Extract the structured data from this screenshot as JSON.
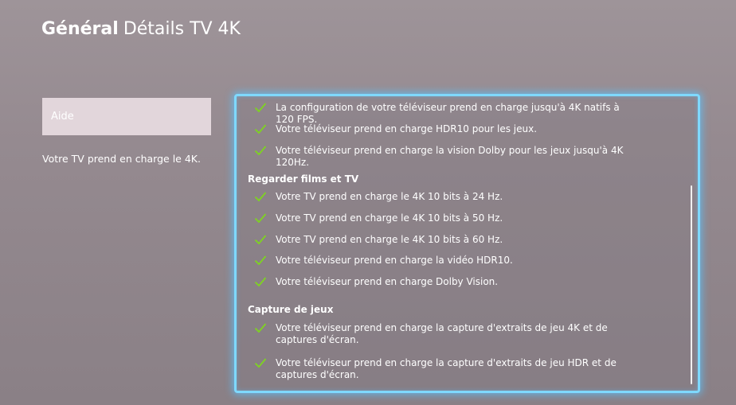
{
  "header": {
    "section": "Général",
    "title": "Détails TV 4K"
  },
  "sidebar": {
    "help_button": "Aide",
    "description": "Votre TV prend en charge le 4K."
  },
  "details": {
    "items_top": [
      "La configuration de votre téléviseur prend en charge jusqu'à 4K natifs à 120 FPS.",
      "Votre téléviseur prend en charge HDR10 pour les jeux.",
      "Votre téléviseur prend en charge la vision Dolby pour les jeux jusqu'à 4K 120Hz."
    ],
    "section_movies": "Regarder films et TV",
    "items_movies": [
      "Votre TV prend en charge le 4K 10 bits à 24 Hz.",
      "Votre TV prend en charge le 4K 10 bits à 50 Hz.",
      "Votre TV prend en charge le 4K 10 bits à 60 Hz.",
      "Votre téléviseur prend en charge la vidéo HDR10.",
      "Votre téléviseur prend en charge Dolby Vision."
    ],
    "section_capture": "Capture de jeux",
    "items_capture": [
      "Votre téléviseur prend en charge la capture d'extraits de jeu 4K et de captures d'écran.",
      "Votre téléviseur prend en charge la capture d'extraits de jeu HDR et de captures d'écran."
    ]
  },
  "icons": {
    "check": "check-icon"
  },
  "colors": {
    "check": "#7ed321",
    "focus": "#7fd9ff"
  }
}
